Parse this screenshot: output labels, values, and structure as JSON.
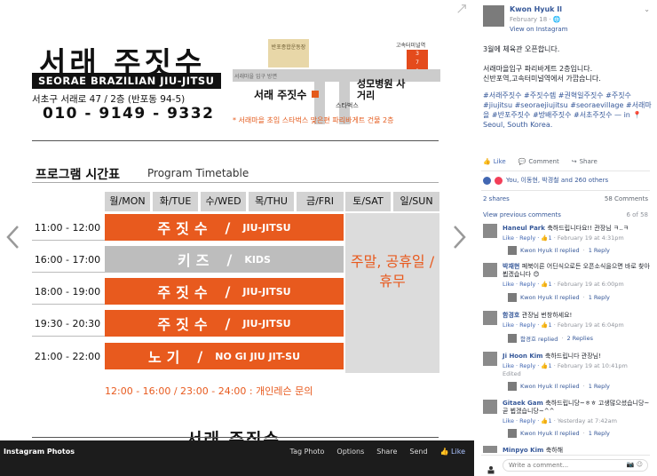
{
  "poster": {
    "logo_title": "서래 주짓수",
    "logo_subtitle": "SEORAE BRAZILIAN JIU-JITSU",
    "address": "서초구 서래로 47 / 2층 (반포동 94-5)",
    "phone": "010 - 9149 - 9332",
    "map": {
      "building1": "반포종합운동장",
      "station": "고속터미널역",
      "station_exits": [
        "3",
        "7",
        "9"
      ],
      "road": "서래마을 입구 방면",
      "gym": "서래 주짓수",
      "starbucks": "스타벅스",
      "hospital": "성모병원 사거리",
      "note": "* 서래마을 초입 스타벅스 맞은편 파리바게트 건물 2층"
    },
    "timetable_title": "프로그램 시간표",
    "timetable_title_en": "Program Timetable",
    "days": [
      "월/MON",
      "화/TUE",
      "수/WED",
      "목/THU",
      "금/FRI",
      "토/SAT",
      "일/SUN"
    ],
    "rows": [
      {
        "time": "11:00 - 12:00",
        "ko": "주짓수",
        "en": "JIU-JITSU",
        "color": "orange"
      },
      {
        "time": "16:00 - 17:00",
        "ko": "키즈",
        "en": "KIDS",
        "color": "gray"
      },
      {
        "time": "18:00 - 19:00",
        "ko": "주짓수",
        "en": "JIU-JITSU",
        "color": "orange"
      },
      {
        "time": "19:30 - 20:30",
        "ko": "주짓수",
        "en": "JIU-JITSU",
        "color": "orange"
      },
      {
        "time": "21:00 - 22:00",
        "ko": "노기",
        "en": "NO GI JIU JIT-SU",
        "color": "orange"
      }
    ],
    "weekend_text": "주말, 공휴일 / 휴무",
    "footnote": "12:00 - 16:00 / 23:00 - 24:00 : 개인레슨 문의",
    "bottom_logo": "서래 주짓수"
  },
  "photo_bar": {
    "album": "Instagram Photos",
    "actions": [
      "Tag Photo",
      "Options",
      "Share",
      "Send"
    ],
    "like": "Like"
  },
  "post": {
    "author": "Kwon Hyuk Il",
    "date": "February 18 ·",
    "via": "View on Instagram",
    "line1": "3월에 체육관 오픈합니다.",
    "line2": "서래마을입구 파리바게트 2층입니다.",
    "line3": "신반포역,고속터미널역에서 가깝습니다.",
    "hashtags": "#서래주짓수 #주짓수렙 #권혁일주짓수 #주짓수 #jiujitsu #seoraejiujitsu #seoraevillage #서래마을 #반포주짓수 #방배주짓수 #서초주짓수 — in",
    "location": "Seoul, South Korea.",
    "action_like": "Like",
    "action_comment": "Comment",
    "action_share": "Share",
    "reactions": "You, 이동현, 박경철 and 260 others",
    "shares": "2 shares",
    "comments_count": "58 Comments",
    "view_previous": "View previous comments",
    "page_of": "6 of 58"
  },
  "comments": [
    {
      "name": "Haneul Park",
      "text": "축하드립니다요!! 관장님 ㅋ..ㅋ",
      "meta_actions": "Like · Reply ·",
      "likes": "1",
      "time": "February 19 at 4:31pm",
      "reply": "Kwon Hyuk Il replied",
      "reply_count": "1 Reply"
    },
    {
      "name": "박재현",
      "text": "페북이른 어딘식으로든 오픈소식을으면 바로 찾아뵙겠습니다 😊",
      "meta_actions": "Like · Reply ·",
      "likes": "1",
      "time": "February 19 at 6:00pm",
      "reply": "Kwon Hyuk Il replied",
      "reply_count": "1 Reply"
    },
    {
      "name": "함경호",
      "text": "관장님 번창하세요!",
      "meta_actions": "Like · Reply ·",
      "likes": "1",
      "time": "February 19 at 6:04pm",
      "reply": "함경호 replied",
      "reply_count": "2 Replies"
    },
    {
      "name": "Ji Hoon Kim",
      "text": "축하드립니다 관장님!",
      "meta_actions": "Like · Reply ·",
      "likes": "1",
      "time": "February 19 at 10:41pm",
      "edited": "Edited",
      "reply": "Kwon Hyuk Il replied",
      "reply_count": "1 Reply"
    },
    {
      "name": "Gitaek Gam",
      "text": "축하드립니당~ㅎㅎ 고생많으셨습니당~곧 뵙겠습니당~^^",
      "meta_actions": "Like · Reply ·",
      "likes": "1",
      "time": "Yesterday at 7:42am",
      "reply": "Kwon Hyuk Il replied",
      "reply_count": "1 Reply"
    },
    {
      "name": "Minpyo Kim",
      "text": "축하해"
    }
  ],
  "write_placeholder": "Write a comment...",
  "colors": {
    "accent_orange": "#e85a1e",
    "fb_blue": "#365899",
    "photo_bar_bg": "#1c1c1c"
  }
}
